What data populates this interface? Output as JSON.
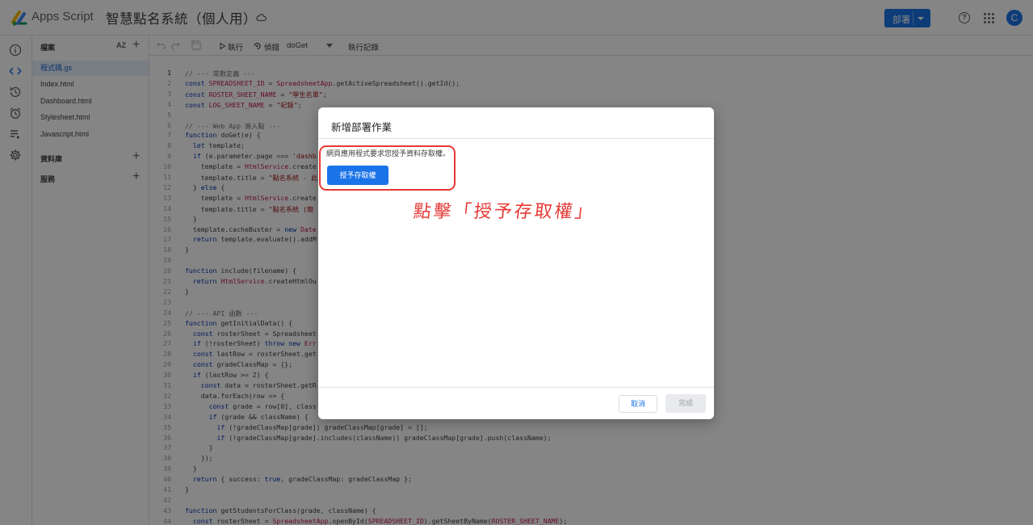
{
  "header": {
    "brand": "Apps Script",
    "project_title": "智慧點名系統（個人用）",
    "deploy_label": "部署",
    "avatar_letter": "C"
  },
  "files_panel": {
    "files_heading": "檔案",
    "sort_label": "AZ",
    "files": [
      "程式碼.gs",
      "Index.html",
      "Dashboard.html",
      "Stylesheet.html",
      "Javascript.html"
    ],
    "libraries_heading": "資料庫",
    "services_heading": "服務"
  },
  "toolbar": {
    "run_label": "執行",
    "debug_label": "偵錯",
    "function_select": "doGet",
    "log_label": "執行記錄"
  },
  "code_lines": [
    {
      "n": "1",
      "t": "// --- 常數定義 ---"
    },
    {
      "n": "2",
      "t": "const SPREADSHEET_ID = SpreadsheetApp.getActiveSpreadsheet().getId();"
    },
    {
      "n": "3",
      "t": "const ROSTER_SHEET_NAME = \"學生名單\";"
    },
    {
      "n": "4",
      "t": "const LOG_SHEET_NAME = \"紀錄\";"
    },
    {
      "n": "5",
      "t": ""
    },
    {
      "n": "6",
      "t": "// --- Web App 進入點 ---"
    },
    {
      "n": "7",
      "t": "function doGet(e) {"
    },
    {
      "n": "8",
      "t": "  let template;"
    },
    {
      "n": "9",
      "t": "  if (e.parameter.page === 'dashb"
    },
    {
      "n": "10",
      "t": "    template = HtmlService.create"
    },
    {
      "n": "11",
      "t": "    template.title = \"點名系統 - 此"
    },
    {
      "n": "12",
      "t": "  } else {"
    },
    {
      "n": "13",
      "t": "    template = HtmlService.create"
    },
    {
      "n": "14",
      "t": "    template.title = \"點名系統 (簡"
    },
    {
      "n": "15",
      "t": "  }"
    },
    {
      "n": "16",
      "t": "  template.cacheBuster = new Date"
    },
    {
      "n": "17",
      "t": "  return template.evaluate().addM"
    },
    {
      "n": "18",
      "t": "}"
    },
    {
      "n": "19",
      "t": ""
    },
    {
      "n": "20",
      "t": "function include(filename) {"
    },
    {
      "n": "21",
      "t": "  return HtmlService.createHtmlOu"
    },
    {
      "n": "22",
      "t": "}"
    },
    {
      "n": "23",
      "t": ""
    },
    {
      "n": "24",
      "t": "// --- API 函數 ---"
    },
    {
      "n": "25",
      "t": "function getInitialData() {"
    },
    {
      "n": "26",
      "t": "  const rosterSheet = Spreadsheet"
    },
    {
      "n": "27",
      "t": "  if (!rosterSheet) throw new Err"
    },
    {
      "n": "28",
      "t": "  const lastRow = rosterSheet.get"
    },
    {
      "n": "29",
      "t": "  const gradeClassMap = {};"
    },
    {
      "n": "30",
      "t": "  if (lastRow >= 2) {"
    },
    {
      "n": "31",
      "t": "    const data = rosterSheet.getR"
    },
    {
      "n": "32",
      "t": "    data.forEach(row => {"
    },
    {
      "n": "33",
      "t": "      const grade = row[0], class"
    },
    {
      "n": "34",
      "t": "      if (grade && className) {"
    },
    {
      "n": "35",
      "t": "        if (!gradeClassMap[grade]) gradeClassMap[grade] = [];"
    },
    {
      "n": "36",
      "t": "        if (!gradeClassMap[grade].includes(className)) gradeClassMap[grade].push(className);"
    },
    {
      "n": "37",
      "t": "      }"
    },
    {
      "n": "38",
      "t": "    });"
    },
    {
      "n": "39",
      "t": "  }"
    },
    {
      "n": "40",
      "t": "  return { success: true, gradeClassMap: gradeClassMap };"
    },
    {
      "n": "41",
      "t": "}"
    },
    {
      "n": "42",
      "t": ""
    },
    {
      "n": "43",
      "t": "function getStudentsForClass(grade, className) {"
    },
    {
      "n": "44",
      "t": "  const rosterSheet = SpreadsheetApp.openById(SPREADSHEET_ID).getSheetByName(ROSTER_SHEET_NAME);"
    }
  ],
  "dialog": {
    "title": "新增部署作業",
    "message": "網頁應用程式要求您授予資料存取權。",
    "authorize_label": "授予存取權",
    "annotation": "點擊「授予存取權」",
    "cancel_label": "取消",
    "done_label": "完成"
  },
  "colors": {
    "accent": "#1a73e8",
    "annotation_red": "#e53935"
  }
}
